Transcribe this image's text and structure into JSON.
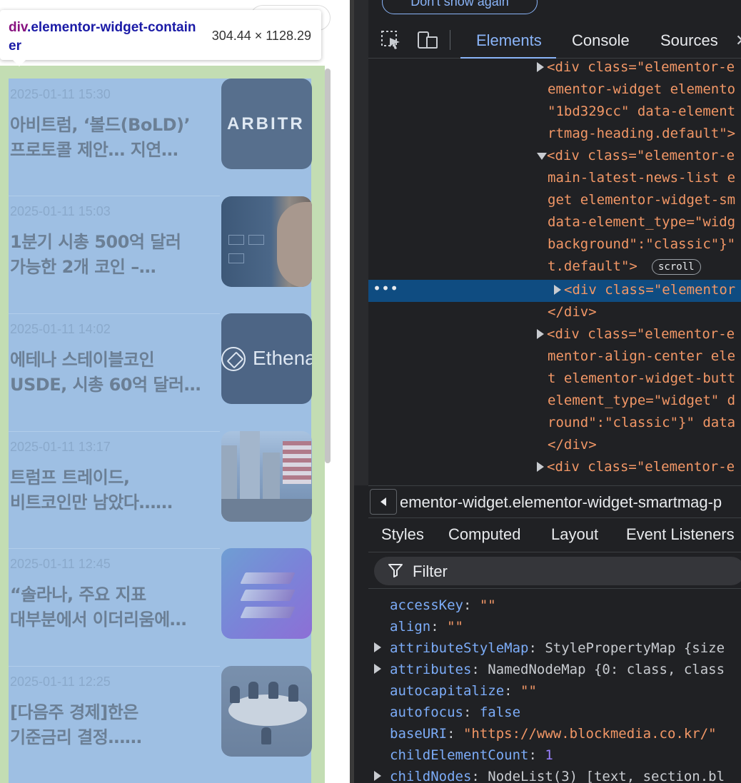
{
  "tooltip": {
    "tag": "div",
    "class_name": ".elementor-widget-container",
    "size": "304.44 × 1128.29"
  },
  "news": [
    {
      "date": "2025-01-11 15:30",
      "title_line1": "아비트럼, ‘볼드(BoLD)’",
      "title_line2": "프로토콜 제안… 지연…",
      "thumb": "arbitrum-logo",
      "thumb_text": "ARBITR"
    },
    {
      "date": "2025-01-11 15:03",
      "title_line1": "1분기 시총 500억 달러",
      "title_line2": "가능한 2개 코인 –…",
      "thumb": "man-portrait"
    },
    {
      "date": "2025-01-11 14:02",
      "title_line1": "에테나 스테이블코인",
      "title_line2": "USDE, 시총 60억 달러…",
      "thumb": "ethena-logo",
      "thumb_text": "Ethena"
    },
    {
      "date": "2025-01-11 13:17",
      "title_line1": "트럼프 트레이드,",
      "title_line2": "비트코인만 남았다……",
      "thumb": "wall-street-photo"
    },
    {
      "date": "2025-01-11 12:45",
      "title_line1": "“솔라나, 주요 지표",
      "title_line2": "대부분에서 이더리움에…",
      "thumb": "solana-logo"
    },
    {
      "date": "2025-01-11 12:25",
      "title_line1": "[다음주 경제]한은",
      "title_line2": "기준금리 결정……",
      "thumb": "meeting-photo"
    }
  ],
  "devtools": {
    "dont_show_label": "Don't show again",
    "tabs": [
      "Elements",
      "Console",
      "Sources"
    ],
    "active_tab": "Elements",
    "dom_lines": [
      {
        "tri": "right",
        "text": "<div class=\"elementor-e"
      },
      {
        "tri": "",
        "text": "ementor-widget elemento"
      },
      {
        "tri": "",
        "text": "\"1bd329cc\" data-element"
      },
      {
        "tri": "",
        "text": "rtmag-heading.default\">"
      },
      {
        "tri": "down",
        "text": "<div class=\"elementor-e"
      },
      {
        "tri": "",
        "text": "main-latest-news-list e"
      },
      {
        "tri": "",
        "text": "get elementor-widget-sm"
      },
      {
        "tri": "",
        "text": "data-element_type=\"widg"
      },
      {
        "tri": "",
        "text": "background\":\"classic\"}\""
      },
      {
        "tri": "",
        "text": "t.default\">",
        "badge": "scroll"
      },
      {
        "tri": "right",
        "text": "<div class=\"elementor",
        "selected": true
      },
      {
        "tri": "",
        "text": "</div>"
      },
      {
        "tri": "right",
        "text": "<div class=\"elementor-e"
      },
      {
        "tri": "",
        "text": "mentor-align-center ele"
      },
      {
        "tri": "",
        "text": "t elementor-widget-butt"
      },
      {
        "tri": "",
        "text": "element_type=\"widget\" d"
      },
      {
        "tri": "",
        "text": "round\":\"classic\"}\" data"
      },
      {
        "tri": "",
        "text": "</div>"
      },
      {
        "tri": "right",
        "text": "<div class=\"elementor-e"
      }
    ],
    "selected_dots": "•••",
    "breadcrumb": "ementor-widget.elementor-widget-smartmag-p",
    "subtabs": [
      "Styles",
      "Computed",
      "Layout",
      "Event Listeners"
    ],
    "filter_label": "Filter",
    "properties": [
      {
        "expand": false,
        "key": "accessKey",
        "value": "\"\"",
        "kind": "str"
      },
      {
        "expand": false,
        "key": "align",
        "value": "\"\"",
        "kind": "str"
      },
      {
        "expand": true,
        "key": "attributeStyleMap",
        "value": "StylePropertyMap {size",
        "kind": "plain"
      },
      {
        "expand": true,
        "key": "attributes",
        "value": "NamedNodeMap {0: class, class",
        "kind": "plain"
      },
      {
        "expand": false,
        "key": "autocapitalize",
        "value": "\"\"",
        "kind": "str"
      },
      {
        "expand": false,
        "key": "autofocus",
        "value": "false",
        "kind": "kw"
      },
      {
        "expand": false,
        "key": "baseURI",
        "value": "\"https://www.blockmedia.co.kr/\"",
        "kind": "str"
      },
      {
        "expand": false,
        "key": "childElementCount",
        "value": "1",
        "kind": "num"
      },
      {
        "expand": true,
        "key": "childNodes",
        "value": "NodeList(3) [text, section.bl",
        "kind": "plain"
      }
    ]
  },
  "colors": {
    "widget_padding": "#c3ddb3",
    "widget_content": "#9ebfe3",
    "devtools_bg": "#202124",
    "accent_blue": "#8ab4f8",
    "selected_row": "#0f4c81"
  }
}
